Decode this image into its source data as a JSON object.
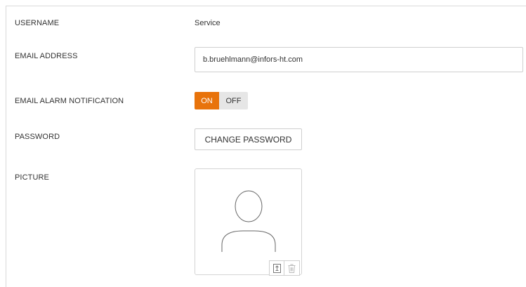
{
  "profile": {
    "username": {
      "label": "USERNAME",
      "value": "Service"
    },
    "email": {
      "label": "EMAIL ADDRESS",
      "value": "b.bruehlmann@infors-ht.com"
    },
    "alarm": {
      "label": "EMAIL ALARM NOTIFICATION",
      "on_label": "ON",
      "off_label": "OFF",
      "state": "on",
      "active_color": "#e8730b"
    },
    "password": {
      "label": "PASSWORD",
      "button_label": "CHANGE PASSWORD"
    },
    "picture": {
      "label": "PICTURE",
      "placeholder_icon": "user-silhouette-icon",
      "upload_icon": "upload-file-icon",
      "delete_icon": "trash-icon"
    }
  }
}
